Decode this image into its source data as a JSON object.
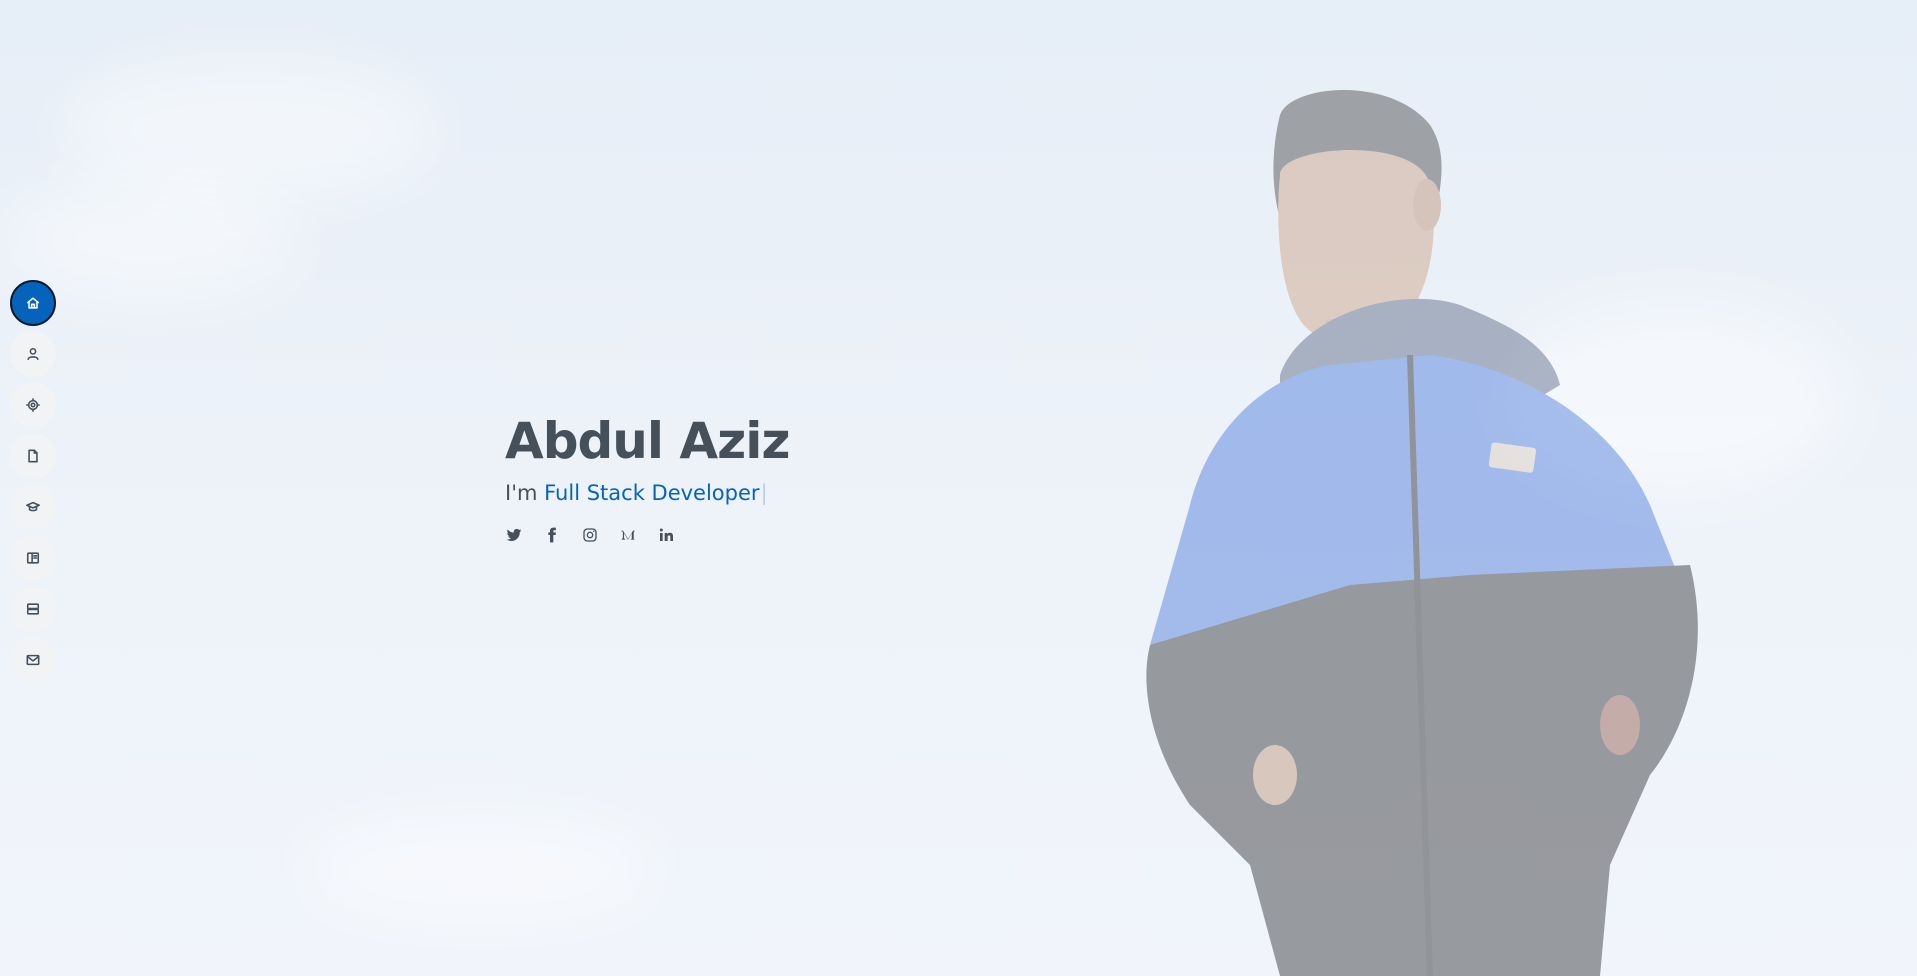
{
  "hero": {
    "name": "Abdul Aziz",
    "prefix": "I'm",
    "typed_text": "Full Stack Developer",
    "cursor": "|"
  },
  "nav": {
    "items": [
      {
        "icon": "home-icon",
        "active": true
      },
      {
        "icon": "person-icon",
        "active": false
      },
      {
        "icon": "skills-icon",
        "active": false
      },
      {
        "icon": "file-icon",
        "active": false
      },
      {
        "icon": "education-icon",
        "active": false
      },
      {
        "icon": "book-icon",
        "active": false
      },
      {
        "icon": "server-icon",
        "active": false
      },
      {
        "icon": "envelope-icon",
        "active": false
      }
    ]
  },
  "social": [
    {
      "icon": "twitter-icon"
    },
    {
      "icon": "facebook-icon"
    },
    {
      "icon": "instagram-icon"
    },
    {
      "icon": "medium-icon"
    },
    {
      "icon": "linkedin-icon"
    }
  ],
  "colors": {
    "accent": "#0563bb",
    "text": "#45505b",
    "nav_bg": "#f2f3f5"
  }
}
